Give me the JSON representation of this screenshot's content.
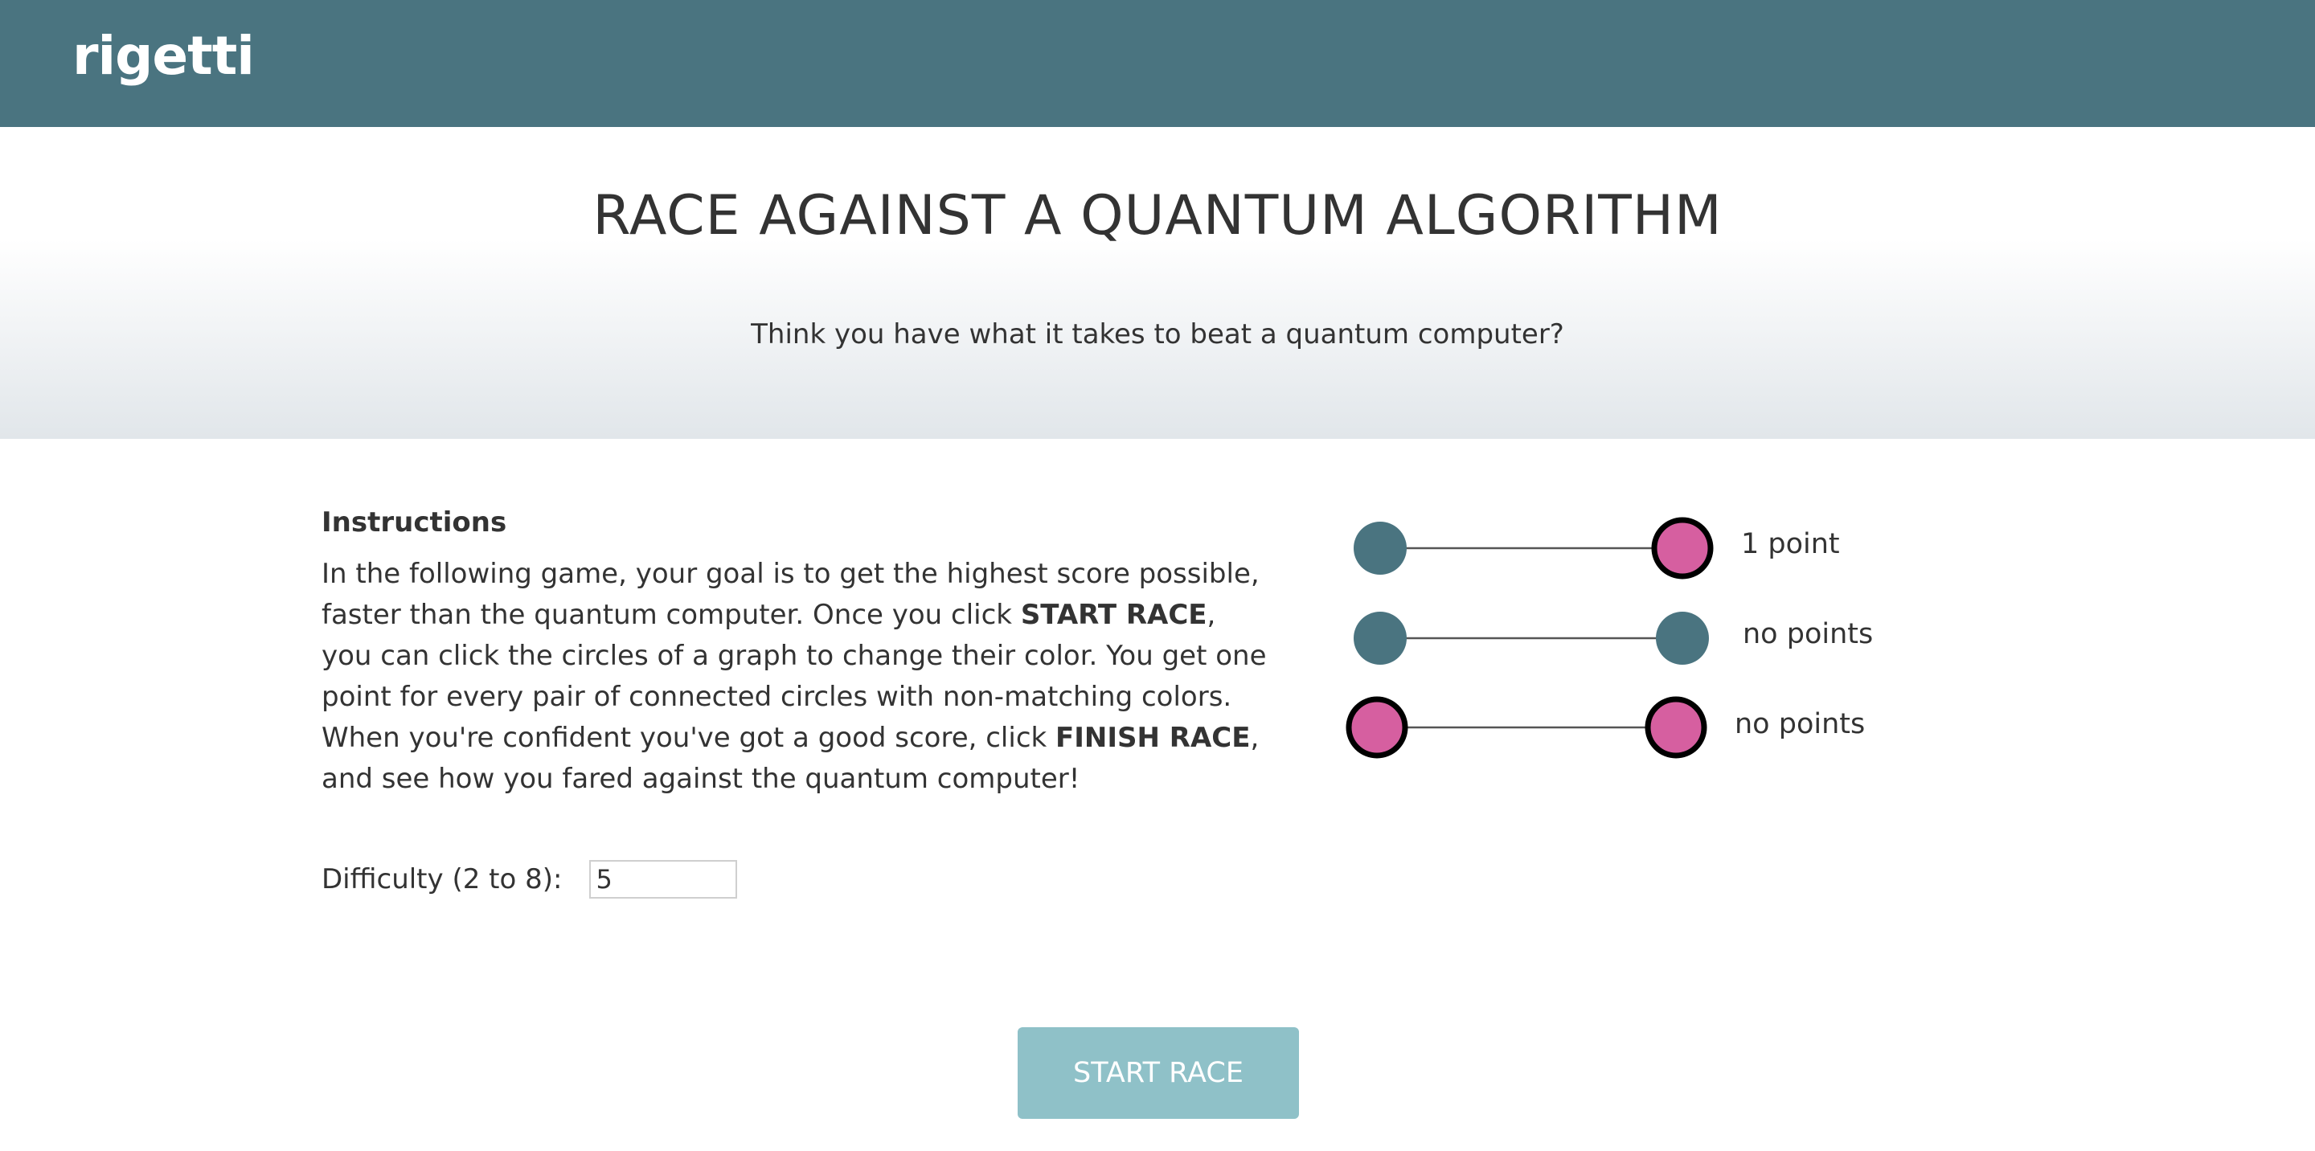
{
  "header": {
    "logo_text": "rigetti"
  },
  "hero": {
    "title": "RACE AGAINST A QUANTUM ALGORITHM",
    "subtitle": "Think you have what it takes to beat a quantum computer?"
  },
  "instructions": {
    "heading": "Instructions",
    "text_1": "In the following game, your goal is to get the highest score possible, faster than the quantum computer. Once you click ",
    "bold_1": "START RACE",
    "text_2": ", you can click the circles of a graph to change their color. You get one point for every pair of connected circles with non-matching colors. When you're confident you've got a good score, click ",
    "bold_2": "FINISH RACE",
    "text_3": ", and see how you fared against the quantum computer!"
  },
  "difficulty": {
    "label": "Difficulty (2 to 8):",
    "value": "5"
  },
  "legend": {
    "rows": [
      {
        "left_node": "teal",
        "right_node": "pink",
        "label": "1 point"
      },
      {
        "left_node": "teal",
        "right_node": "teal",
        "label": "no points"
      },
      {
        "left_node": "pink",
        "right_node": "pink",
        "label": "no points"
      }
    ]
  },
  "colors": {
    "header_bg": "#4a7480",
    "node_teal": "#4a7480",
    "node_pink": "#d65fa0",
    "node_outline": "#000000",
    "button_bg": "#8fc1c8"
  },
  "start_button": {
    "label": "START RACE"
  }
}
